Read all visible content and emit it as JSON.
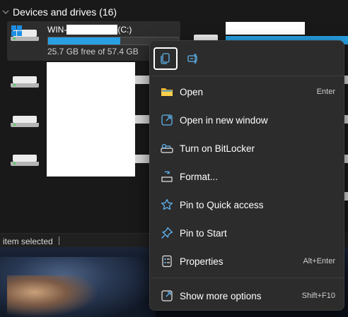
{
  "section": {
    "title": "Devices and drives (16)"
  },
  "drive_c": {
    "name_prefix": "WIN-",
    "name_suffix": "(C:)",
    "free_text": "25.7 GB free of 57.4 GB",
    "used_fraction": 0.552
  },
  "status_bar": {
    "text": "item selected"
  },
  "context_menu": {
    "quick_actions": [
      {
        "icon": "copy-icon"
      },
      {
        "icon": "rename-icon"
      }
    ],
    "items": [
      {
        "label": "Open",
        "shortcut": "Enter",
        "icon": "folder-open-icon"
      },
      {
        "label": "Open in new window",
        "shortcut": "",
        "icon": "new-window-icon"
      },
      {
        "label": "Turn on BitLocker",
        "shortcut": "",
        "icon": "bitlocker-key-icon"
      },
      {
        "label": "Format...",
        "shortcut": "",
        "icon": "format-drive-icon"
      },
      {
        "label": "Pin to Quick access",
        "shortcut": "",
        "icon": "star-icon"
      },
      {
        "label": "Pin to Start",
        "shortcut": "",
        "icon": "pin-icon"
      },
      {
        "label": "Properties",
        "shortcut": "Alt+Enter",
        "icon": "properties-icon"
      },
      {
        "label": "Show more options",
        "shortcut": "Shift+F10",
        "icon": "more-options-icon"
      }
    ]
  },
  "colors": {
    "accent": "#28a0e3",
    "menu_bg": "#2c2c2c",
    "explorer_bg": "#191919"
  }
}
